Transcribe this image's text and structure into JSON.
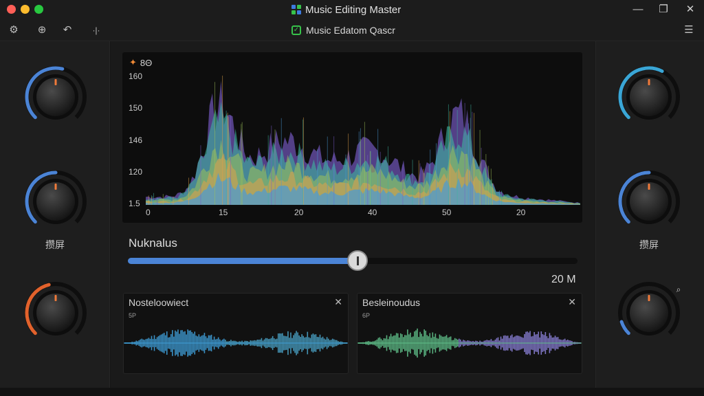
{
  "window": {
    "title": "Music Editing Master",
    "minimize_icon": "minimize-icon",
    "maximize_icon": "maximize-icon",
    "close_icon": "close-icon",
    "logo_colors": [
      "#3d7be0",
      "#37c24a",
      "#37c24a",
      "#3d7be0"
    ]
  },
  "toolbar": {
    "project_name": "Music Edatom Qascr",
    "icons": [
      "settings-icon",
      "globe-icon",
      "undo-icon",
      "split-icon",
      "list-settings-icon"
    ]
  },
  "spectrum": {
    "label": "8Θ",
    "icon": "spectrum-icon",
    "y_ticks": [
      "160",
      "150",
      "146",
      "120",
      "1.5"
    ],
    "x_ticks": [
      "0",
      "15",
      "20",
      "40",
      "50",
      "20"
    ]
  },
  "slider": {
    "label": "Nuknalus",
    "value_fraction": 0.51,
    "value_text": "20 M",
    "fill_color": "#4b84d6"
  },
  "waveforms": [
    {
      "title": "Nosteloowiect",
      "small_label": "5P",
      "close_icon": "close-icon",
      "colors": [
        "#3f9fd8",
        "#4aa3c8"
      ]
    },
    {
      "title": "Besleinoudus",
      "small_label": "6P",
      "close_icon": "close-icon",
      "colors": [
        "#5fc08a",
        "#8a7fd6"
      ]
    }
  ],
  "knobs_left": [
    {
      "level": 0.55,
      "color": "#4b84d6"
    },
    {
      "level": 0.5,
      "color": "#4b84d6"
    },
    {
      "level": 0.45,
      "color": "#e2622c"
    }
  ],
  "knobs_right": [
    {
      "level": 0.6,
      "color": "#3aa6d6"
    },
    {
      "level": 0.5,
      "color": "#4b84d6"
    },
    {
      "level": 0.1,
      "color": "#4b84d6"
    }
  ],
  "labels": {
    "left": "攒屏",
    "right": "攒屏"
  },
  "zoom_icon": "zoom-icon"
}
